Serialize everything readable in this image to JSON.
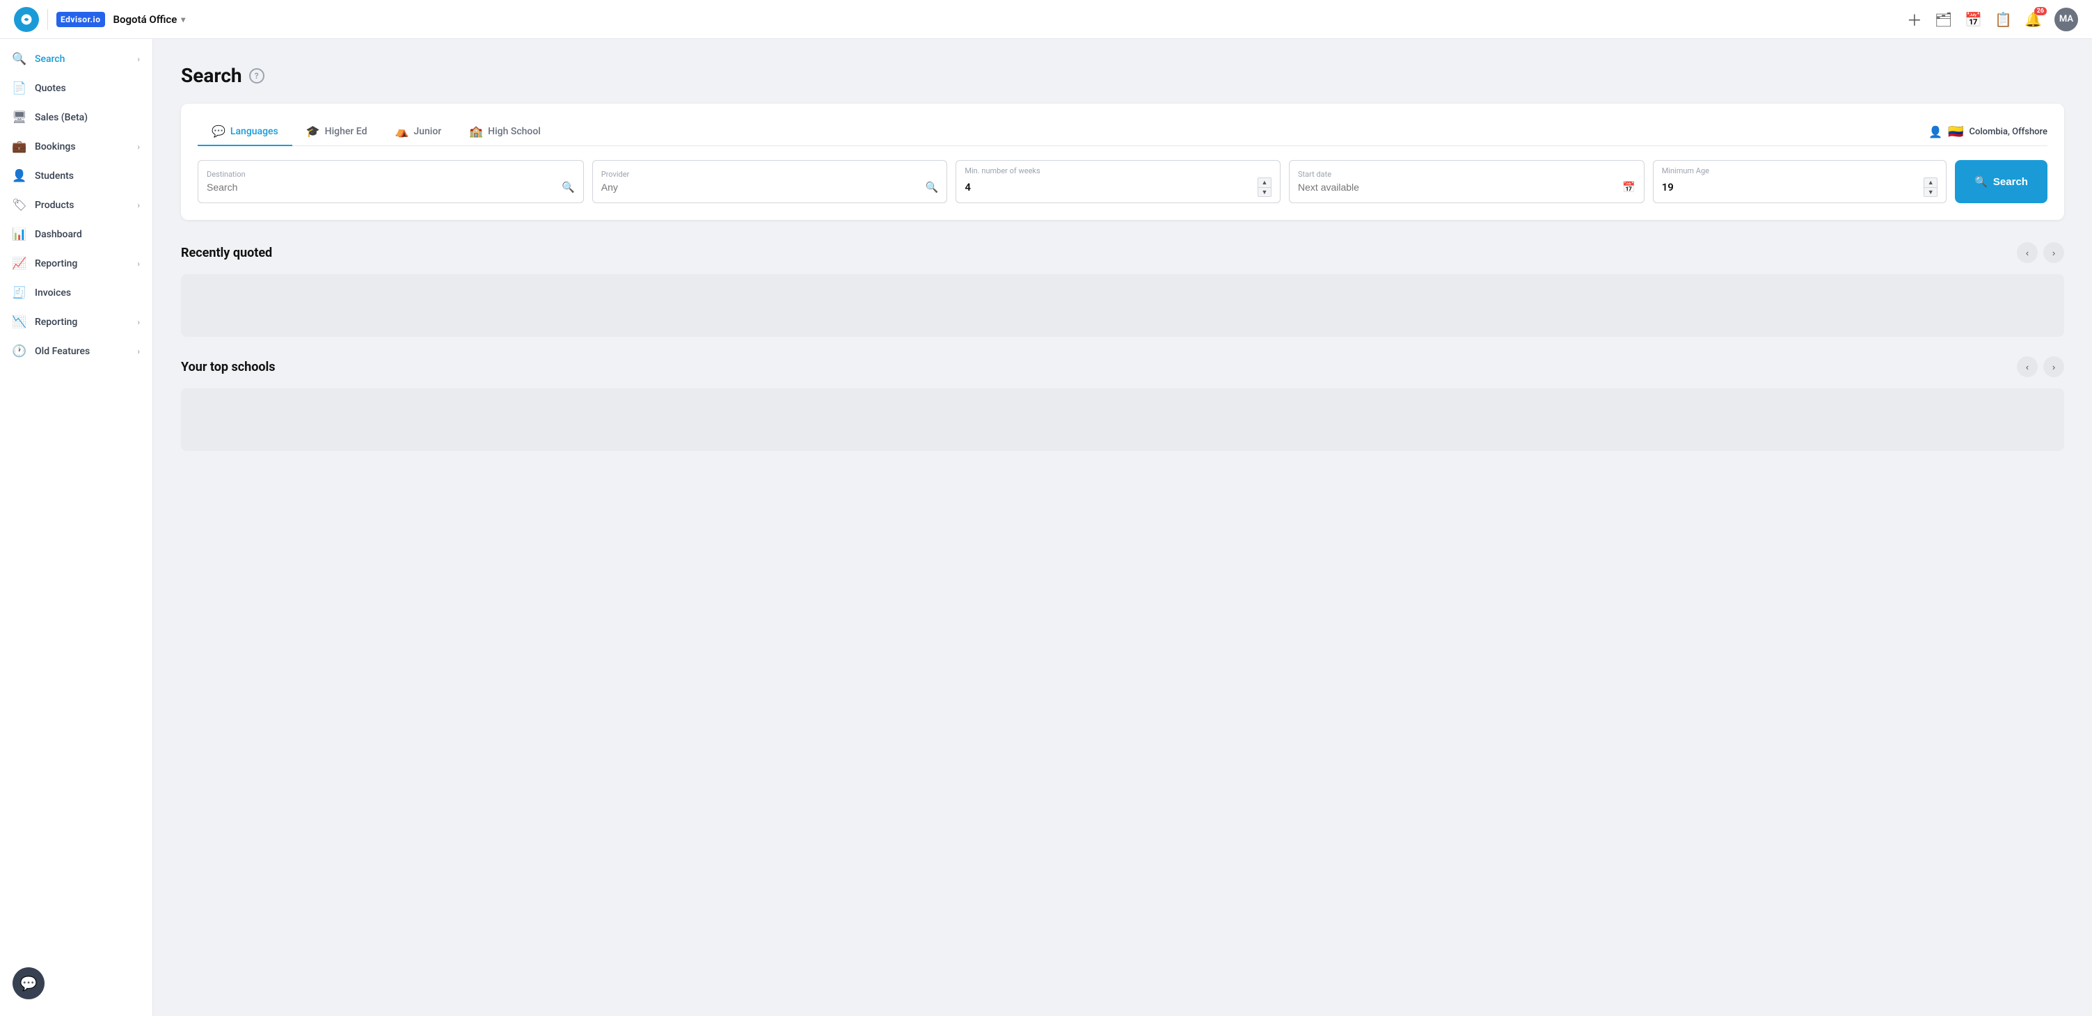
{
  "topnav": {
    "office_name": "Bogotá Office",
    "brand_label": "Edvisor.io",
    "notification_count": "26",
    "avatar_initials": "MA"
  },
  "sidebar": {
    "items": [
      {
        "id": "search",
        "label": "Search",
        "icon": "🔍",
        "has_chevron": true,
        "active": true
      },
      {
        "id": "quotes",
        "label": "Quotes",
        "icon": "📄",
        "has_chevron": false
      },
      {
        "id": "sales",
        "label": "Sales (Beta)",
        "icon": "🖥",
        "has_chevron": false
      },
      {
        "id": "bookings",
        "label": "Bookings",
        "icon": "💼",
        "has_chevron": true
      },
      {
        "id": "students",
        "label": "Students",
        "icon": "👤",
        "has_chevron": false
      },
      {
        "id": "products",
        "label": "Products",
        "icon": "🏷",
        "has_chevron": true
      },
      {
        "id": "dashboard",
        "label": "Dashboard",
        "icon": "📊",
        "has_chevron": false
      },
      {
        "id": "reporting1",
        "label": "Reporting",
        "icon": "📈",
        "has_chevron": true
      },
      {
        "id": "invoices",
        "label": "Invoices",
        "icon": "🧾",
        "has_chevron": false
      },
      {
        "id": "reporting2",
        "label": "Reporting",
        "icon": "📉",
        "has_chevron": true
      },
      {
        "id": "oldfeatures",
        "label": "Old Features",
        "icon": "🕐",
        "has_chevron": true
      }
    ]
  },
  "main": {
    "page_title": "Search",
    "help_tooltip": "?",
    "tabs": [
      {
        "id": "languages",
        "label": "Languages",
        "icon": "💬",
        "active": true
      },
      {
        "id": "highered",
        "label": "Higher Ed",
        "icon": "🎓",
        "active": false
      },
      {
        "id": "junior",
        "label": "Junior",
        "icon": "⛺",
        "active": false
      },
      {
        "id": "highschool",
        "label": "High School",
        "icon": "🏫",
        "active": false
      }
    ],
    "location_label": "Colombia, Offshore",
    "filters": {
      "destination": {
        "label": "Destination",
        "placeholder": "Search",
        "value": ""
      },
      "provider": {
        "label": "Provider",
        "placeholder": "Any",
        "value": ""
      },
      "weeks": {
        "label": "Min. number of weeks",
        "value": "4"
      },
      "startdate": {
        "label": "Start date",
        "placeholder": "Next available",
        "value": ""
      },
      "minage": {
        "label": "Minimum Age",
        "value": "19"
      }
    },
    "search_button_label": "Search",
    "recently_quoted_title": "Recently quoted",
    "top_schools_title": "Your top schools"
  }
}
